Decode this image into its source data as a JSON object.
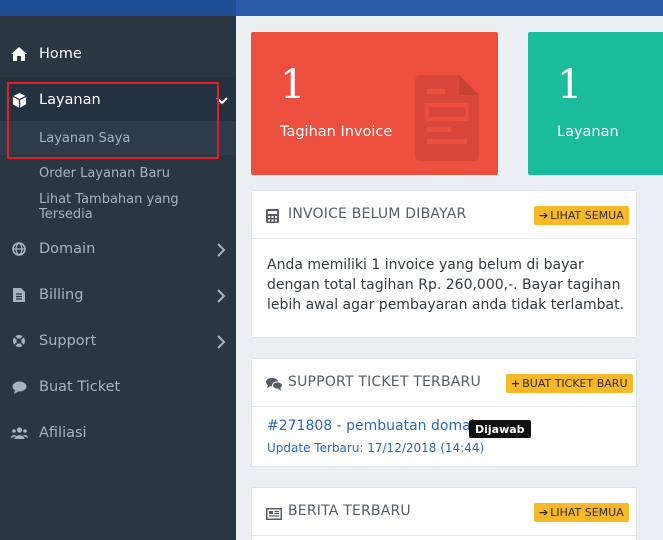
{
  "sidebar": {
    "items": [
      {
        "label": "Home",
        "icon": "home-icon"
      },
      {
        "label": "Layanan",
        "icon": "cube-icon"
      },
      {
        "label": "Domain",
        "icon": "globe-icon"
      },
      {
        "label": "Billing",
        "icon": "file-icon"
      },
      {
        "label": "Support",
        "icon": "lifebuoy-icon"
      },
      {
        "label": "Buat Ticket",
        "icon": "comment-icon"
      },
      {
        "label": "Afiliasi",
        "icon": "users-icon"
      }
    ],
    "layanan_sub": [
      {
        "label": "Layanan Saya"
      },
      {
        "label": "Order Layanan Baru"
      },
      {
        "label": "Lihat Tambahan yang Tersedia"
      }
    ]
  },
  "tiles": [
    {
      "number": "1",
      "caption": "Tagihan Invoice",
      "color": "#ed4f3f"
    },
    {
      "number": "1",
      "caption": "Layanan",
      "color": "#1abc9c"
    }
  ],
  "invoice_panel": {
    "title": "INVOICE BELUM DIBAYAR",
    "button": "LIHAT SEMUA",
    "body": "Anda memiliki 1 invoice yang belum di bayar dengan total tagihan Rp. 260,000,-. Bayar tagihan lebih awal agar pembayaran anda tidak terlambat."
  },
  "support_panel": {
    "title": "SUPPORT TICKET TERBARU",
    "button": "BUAT TICKET BARU",
    "ticket_link": "#271808 - pembuatan domain",
    "ticket_status": "Dijawab",
    "ticket_update": "Update Terbaru: 17/12/2018 (14:44)"
  },
  "news_panel": {
    "title": "BERITA TERBARU",
    "button": "LIHAT SEMUA"
  },
  "colors": {
    "sidebar": "#2b3643",
    "accent_yellow": "#f7b928",
    "link_blue": "#2a68b8"
  }
}
